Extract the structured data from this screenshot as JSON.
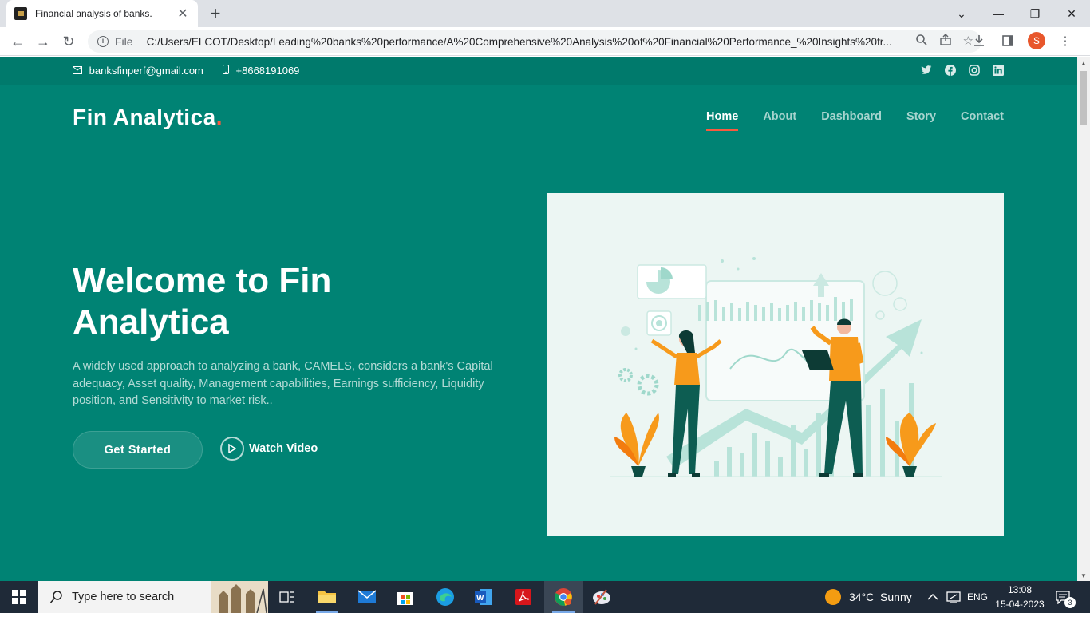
{
  "browser": {
    "tab_title": "Financial analysis of banks.",
    "omnibox_scheme": "File",
    "url": "C:/Users/ELCOT/Desktop/Leading%20banks%20performance/A%20Comprehensive%20Analysis%20of%20Financial%20Performance_%20Insights%20fr...",
    "profile_initial": "S"
  },
  "topbar": {
    "email": "banksfinperf@gmail.com",
    "phone": "+8668191069",
    "socials": [
      "twitter-icon",
      "facebook-icon",
      "instagram-icon",
      "linkedin-icon"
    ]
  },
  "header": {
    "logo": "Fin Analytica",
    "logo_dot": ".",
    "nav": [
      {
        "label": "Home",
        "active": true
      },
      {
        "label": "About",
        "active": false
      },
      {
        "label": "Dashboard",
        "active": false
      },
      {
        "label": "Story",
        "active": false
      },
      {
        "label": "Contact",
        "active": false
      }
    ]
  },
  "hero": {
    "title": "Welcome to Fin Analytica",
    "description": "A widely used approach to analyzing a bank, CAMELS, considers a bank's Capital adequacy, Asset quality, Management capabilities, Earnings sufficiency, Liquidity position, and Sensitivity to market risk..",
    "cta_primary": "Get Started",
    "cta_secondary": "Watch Video"
  },
  "taskbar": {
    "search_placeholder": "Type here to search",
    "weather": "34°C  Sunny",
    "language": "ENG",
    "time": "13:08",
    "date": "15-04-2023",
    "notifications": "3"
  },
  "colors": {
    "brand": "#008374",
    "accent": "#f85a40",
    "illustration_bg": "#ecf6f3"
  }
}
